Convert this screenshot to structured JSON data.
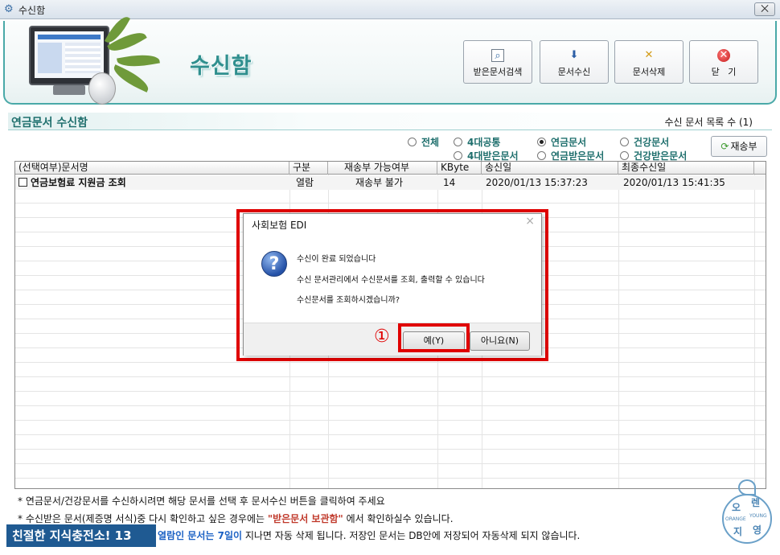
{
  "window": {
    "title": "수신함",
    "close_label": "⨉"
  },
  "header": {
    "page_title": "수신함",
    "buttons": [
      {
        "label": "받은문서검색",
        "icon": "search-document-icon"
      },
      {
        "label": "문서수신",
        "icon": "receive-document-icon"
      },
      {
        "label": "문서삭제",
        "icon": "delete-document-icon"
      },
      {
        "label": "닫   기",
        "icon": "close-circle-icon"
      }
    ]
  },
  "section": {
    "title": "연금문서 수신함",
    "count_text": "수신 문서 목록 수 (1)"
  },
  "filters": {
    "options": [
      {
        "label": "전체",
        "selected": false
      },
      {
        "label": "4대공통",
        "selected": false
      },
      {
        "label": "연금문서",
        "selected": true
      },
      {
        "label": "건강문서",
        "selected": false
      },
      {
        "label": "4대받은문서",
        "selected": false
      },
      {
        "label": "연금받은문서",
        "selected": false
      },
      {
        "label": "건강받은문서",
        "selected": false
      }
    ],
    "resend_label": "재송부"
  },
  "table": {
    "columns": [
      "(선택여부)문서명",
      "구분",
      "재송부 가능여부",
      "KByte",
      "송신일",
      "최종수신일"
    ],
    "rows": [
      {
        "name": "연금보험료 지원금 조회",
        "type": "열람",
        "resend": "재송부 불가",
        "kbyte": "14",
        "sent": "2020/01/13 15:37:23",
        "received": "2020/01/13 15:41:35"
      }
    ]
  },
  "notes": {
    "line1": "* 연금문서/건강문서를 수신하시려면 해당 문서를 선택 후 문서수신 버튼을 클릭하여 주세요",
    "line2_a": "* 수신받은 문서(제증명 서식)중 다시 확인하고 싶은 경우에는 ",
    "line2_b": "\"받은문서 보관함\"",
    "line2_c": " 에서 확인하실수 있습니다.",
    "line3_a": "열람인 문서는 7일이",
    "line3_b": " 지나면 자동 삭제 됩니다. 저장인 문서는 DB안에 저장되어 자동삭제 되지 않습니다."
  },
  "watermark": "친절한 지식충전소! 13",
  "logo": {
    "chars": [
      "오",
      "렌",
      "지",
      "영"
    ],
    "tagline_left": "ORANGE",
    "tagline_right": "YOUNG"
  },
  "dialog": {
    "title": "사회보험 EDI",
    "close": "×",
    "icon": "question-icon",
    "messages": [
      "수신이 완료 되었습니다",
      "수신 문서관리에서 수신문서를 조회, 출력할 수 있습니다",
      "수신문서를 조회하시겠습니까?"
    ],
    "yes_label": "예(Y)",
    "no_label": "아니요(N)",
    "marker": "①"
  },
  "colors": {
    "accent": "#2f8f8e",
    "highlight": "#e00000",
    "watermark_bg": "#1f5a92"
  }
}
